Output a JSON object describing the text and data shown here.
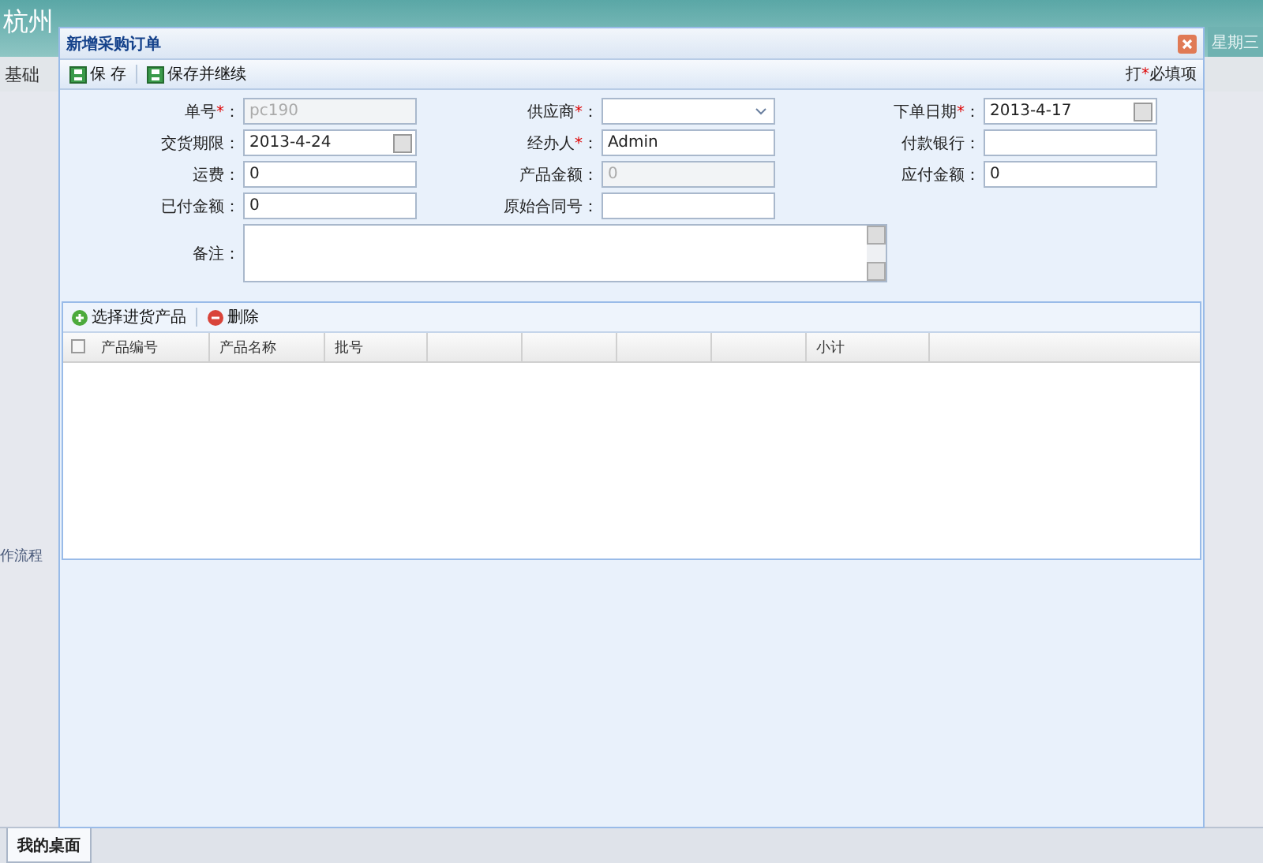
{
  "app": {
    "title": "杭州",
    "weekday": "星期三",
    "nav_text": "基础",
    "side_text": "作流程",
    "bottom_tabs": [
      {
        "label": "我的桌面",
        "selected": true
      }
    ]
  },
  "dialog": {
    "title": "新增采购订单",
    "toolbar": [
      {
        "label": "保 存",
        "kind": "save"
      },
      {
        "label": "保存并继续",
        "kind": "save"
      }
    ],
    "note": {
      "before": "打",
      "mark": "*",
      "after": "必填项"
    },
    "fields": [
      {
        "label": "单号",
        "required": "*",
        "colon": "：",
        "kind": "text",
        "value": "pc190",
        "disabled": true
      },
      {
        "label": "供应商",
        "required": "*",
        "colon": "：",
        "kind": "select",
        "disabled": false
      },
      {
        "label": "下单日期",
        "required": "*",
        "colon": "：",
        "kind": "date",
        "value": "2013-4-17",
        "disabled": false
      },
      {
        "label": "交货期限",
        "colon": "：",
        "kind": "date",
        "value": "2013-4-24",
        "disabled": false
      },
      {
        "label": "经办人",
        "required": "*",
        "colon": "：",
        "kind": "text",
        "value": "Admin",
        "disabled": false
      },
      {
        "label": "付款银行",
        "colon": "：",
        "kind": "text",
        "disabled": false
      },
      {
        "label": "运费",
        "colon": "：",
        "kind": "text",
        "value": "0",
        "disabled": false
      },
      {
        "label": "产品金额",
        "colon": "：",
        "kind": "text",
        "value": "0",
        "disabled": true
      },
      {
        "label": "应付金额",
        "colon": "：",
        "kind": "text",
        "value": "0",
        "disabled": false
      },
      {
        "label": "已付金额",
        "colon": "：",
        "kind": "text",
        "value": "0",
        "disabled": false
      },
      {
        "label": "原始合同号",
        "colon": "：",
        "kind": "text",
        "disabled": false
      }
    ],
    "remark": {
      "label": "备注",
      "colon": "："
    },
    "grid": {
      "toolbar": [
        {
          "label": "选择进货产品",
          "kind": "add"
        },
        {
          "label": "删除",
          "kind": "delete"
        }
      ],
      "select_all": {
        "checked": false
      },
      "columns": [
        {
          "label": "产品编号"
        },
        {
          "label": "产品名称"
        },
        {
          "label": "批号"
        },
        {},
        {},
        {},
        {},
        {
          "label": "小计"
        }
      ]
    }
  }
}
